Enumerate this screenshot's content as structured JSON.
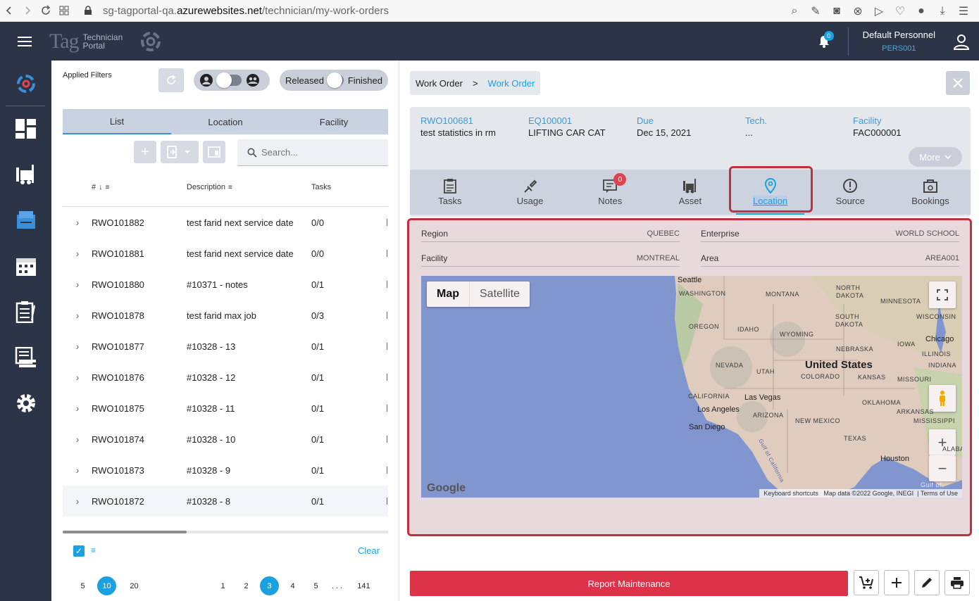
{
  "browser": {
    "url_prefix": "sg-tagportal-qa.",
    "url_host": "azurewebsites.net",
    "url_path": "/technician/my-work-orders"
  },
  "header": {
    "logo_tag": "Tag",
    "logo_line1": "Technician",
    "logo_line2": "Portal",
    "notif_count": "0",
    "user_name": "Default Personnel",
    "user_code": "PERS001"
  },
  "list": {
    "applied_filters": "Applied Filters",
    "toggle_released": "Released",
    "toggle_finished": "Finished",
    "tabs": [
      "List",
      "Location",
      "Facility"
    ],
    "search_placeholder": "Search...",
    "columns": {
      "num": "#",
      "description": "Description",
      "tasks": "Tasks"
    },
    "rows": [
      {
        "num": "RWO101882",
        "desc": "test farid next service date",
        "tasks": "0/0"
      },
      {
        "num": "RWO101881",
        "desc": "test farid next service date",
        "tasks": "0/0"
      },
      {
        "num": "RWO101880",
        "desc": "#10371 - notes",
        "tasks": "0/1"
      },
      {
        "num": "RWO101878",
        "desc": "test farid max job",
        "tasks": "0/3"
      },
      {
        "num": "RWO101877",
        "desc": "#10328 - 13",
        "tasks": "0/1"
      },
      {
        "num": "RWO101876",
        "desc": "#10328 - 12",
        "tasks": "0/1"
      },
      {
        "num": "RWO101875",
        "desc": "#10328 - 11",
        "tasks": "0/1"
      },
      {
        "num": "RWO101874",
        "desc": "#10328 - 10",
        "tasks": "0/1"
      },
      {
        "num": "RWO101873",
        "desc": "#10328 - 9",
        "tasks": "0/1"
      },
      {
        "num": "RWO101872",
        "desc": "#10328 - 8",
        "tasks": "0/1"
      }
    ],
    "clear": "Clear",
    "page_sizes": [
      "5",
      "10",
      "20"
    ],
    "page_size_selected": "10",
    "pages": [
      "1",
      "2",
      "3",
      "4",
      "5",
      ". . .",
      "141"
    ],
    "page_selected": "3"
  },
  "detail": {
    "breadcrumb": {
      "root": "Work Order",
      "sep": ">",
      "current": "Work Order"
    },
    "summary": [
      {
        "key": "RWO100681",
        "value": "test statistics in rm"
      },
      {
        "key": "EQ100001",
        "value": "LIFTING CAR CAT"
      },
      {
        "key": "Due",
        "value": "Dec 15, 2021"
      },
      {
        "key": "Tech.",
        "value": "..."
      },
      {
        "key": "Facility",
        "value": "FAC000001"
      }
    ],
    "more": "More",
    "tabs": [
      "Tasks",
      "Usage",
      "Notes",
      "Asset",
      "Location",
      "Source",
      "Bookings"
    ],
    "active_tab": "Location",
    "notes_count": "0",
    "location": {
      "region_label": "Region",
      "region_value": "QUEBEC",
      "enterprise_label": "Enterprise",
      "enterprise_value": "WORLD SCHOOL",
      "facility_label": "Facility",
      "facility_value": "MONTREAL",
      "area_label": "Area",
      "area_value": "AREA001"
    },
    "map": {
      "map_btn": "Map",
      "satellite_btn": "Satellite",
      "labels": {
        "seattle": "Seattle",
        "washington": "WASHINGTON",
        "montana": "MONTANA",
        "north_dakota_1": "NORTH",
        "north_dakota_2": "DAKOTA",
        "minnesota": "MINNESOTA",
        "south_dakota_1": "SOUTH",
        "south_dakota_2": "DAKOTA",
        "wisconsin": "WISCONSIN",
        "oregon": "OREGON",
        "idaho": "IDAHO",
        "wyoming": "WYOMING",
        "iowa": "IOWA",
        "chicago": "Chicago",
        "nebraska": "NEBRASKA",
        "illinois": "ILLINOIS",
        "nevada": "NEVADA",
        "utah": "UTAH",
        "united_states": "United States",
        "indiana": "INDIANA",
        "colorado": "COLORADO",
        "kansas": "KANSAS",
        "missouri": "MISSOURI",
        "california": "CALIFORNIA",
        "las_vegas": "Las Vegas",
        "oklahoma": "OKLAHOMA",
        "arkansas": "ARKANSAS",
        "los_angeles": "Los Angeles",
        "arizona": "ARIZONA",
        "new_mexico": "NEW MEXICO",
        "mississippi": "MISSISSIPPI",
        "san_diego": "San Diego",
        "texas": "TEXAS",
        "alabama": "ALABA",
        "houston": "Houston",
        "gulf_of_mexico": "Gulf of",
        "gulf_california": "Gulf of California"
      },
      "google": "Google",
      "attribution_shortcuts": "Keyboard shortcuts",
      "attribution_data": "Map data ©2022 Google, INEGI",
      "attribution_terms": "Terms of Use"
    },
    "report_button": "Report Maintenance"
  },
  "colors": {
    "accent": "#1ba1e2",
    "header_bg": "#2c3447",
    "report_red": "#dc3349",
    "highlight_border": "#c1303f"
  }
}
